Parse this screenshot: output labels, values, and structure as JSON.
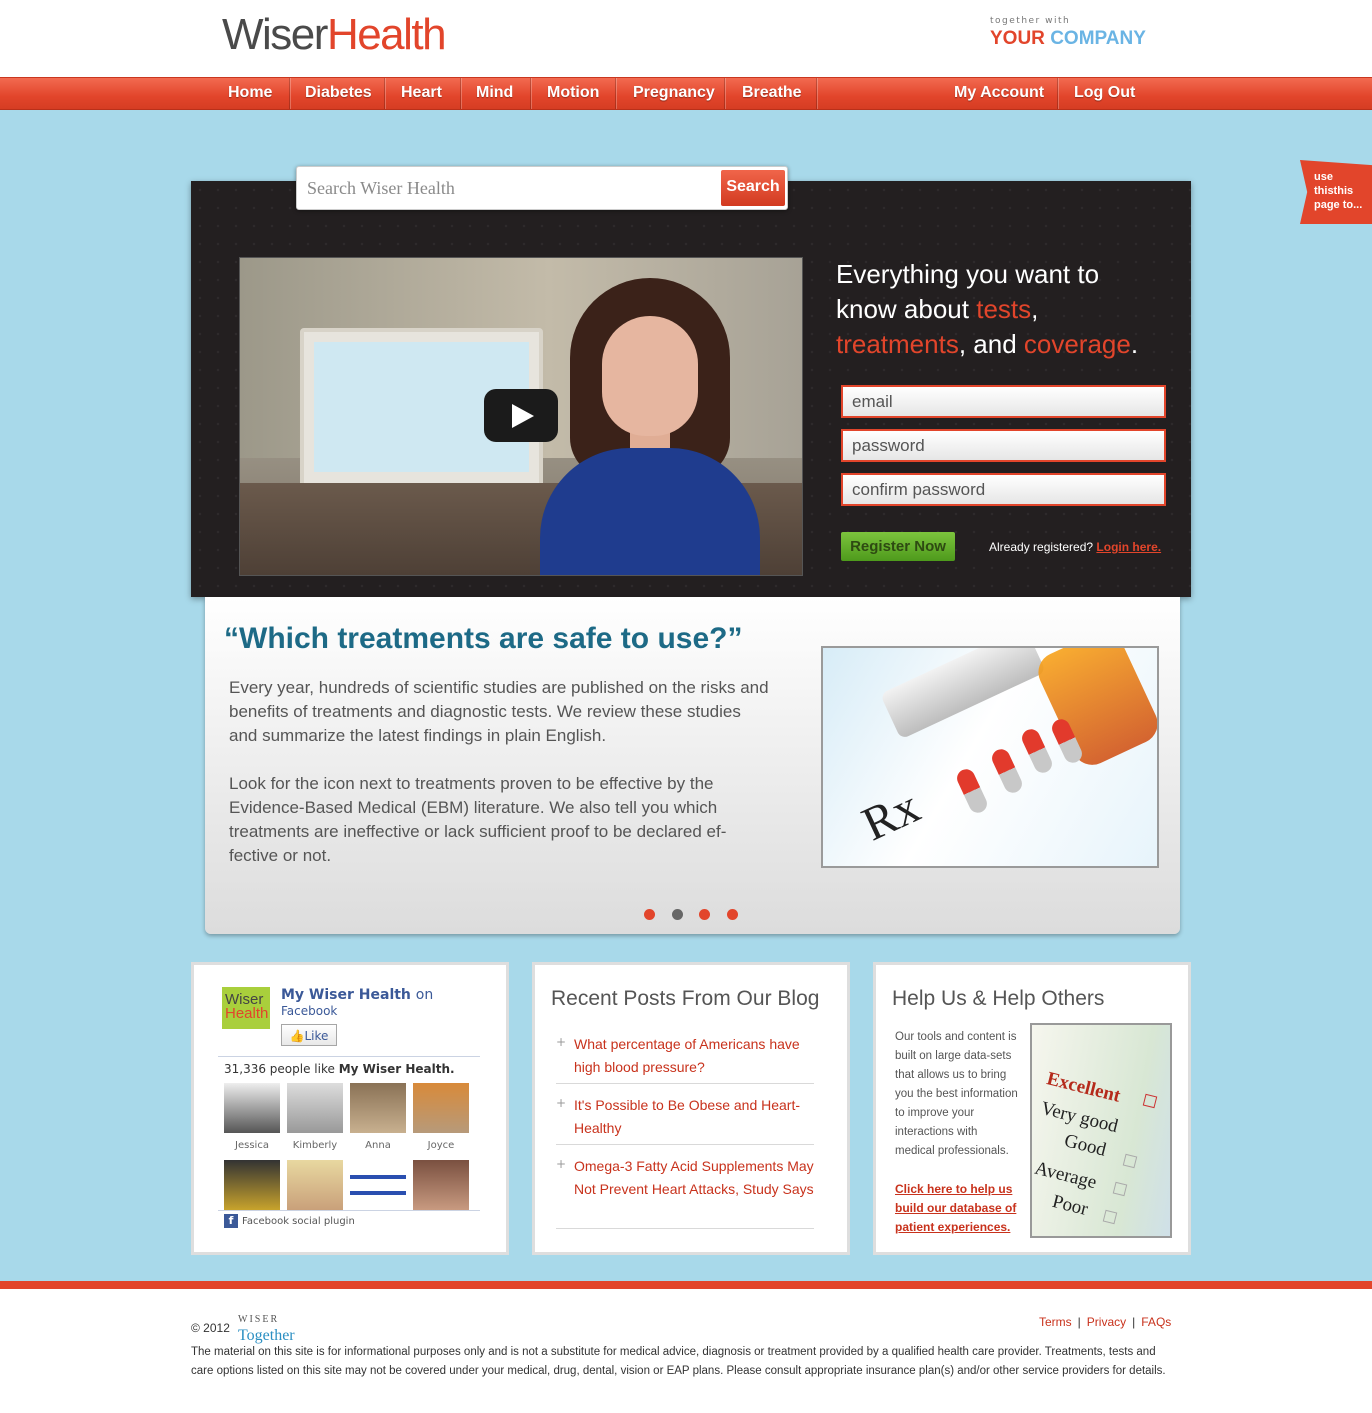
{
  "header": {
    "logo_part1": "Wiser",
    "logo_part2": "Health",
    "partner_small": "together with",
    "partner_your": "YOUR",
    "partner_company": "COMPANY"
  },
  "nav": {
    "items": [
      "Home",
      "Diabetes",
      "Heart",
      "Mind",
      "Motion",
      "Pregnancy",
      "Breathe"
    ],
    "account": "My Account",
    "logout": "Log Out"
  },
  "side_tab": {
    "text": "use thisthis page to..."
  },
  "search": {
    "placeholder": "Search Wiser Health",
    "button": "Search"
  },
  "hero": {
    "headline_1": "Everything you want to know about ",
    "tests": "tests",
    "comma": ", ",
    "treatments": "treatments",
    "and": ", and ",
    "coverage": "coverage",
    "period": ".",
    "email_placeholder": "email",
    "password_placeholder": "password",
    "confirm_placeholder": "confirm password",
    "register_button": "Register Now",
    "already": "Already registered?",
    "login_link": "Login here."
  },
  "slide": {
    "quote": "“Which treatments are safe to use?”",
    "para1": "Every year, hundreds of scientific studies are published on the risks and benefits of treatments and diagnostic tests. We review these studies and summarize the latest findings in plain English.",
    "para2": "Look for the icon next to treatments proven to be effective by the Evidence-Based Medical (EBM) literature. We also tell you which treatments are ineffective or lack sufficient proof to be declared ef-fective or not.",
    "image_label": "Rx",
    "active_dot": 2,
    "dot_count": 4
  },
  "facebook": {
    "logo_1": "Wiser",
    "logo_2": "Health",
    "title": "My Wiser Health",
    "on": "on",
    "facebook": "Facebook",
    "like": "Like",
    "count_text": "31,336 people like",
    "count_page": "My Wiser Health.",
    "fans": [
      "Jessica",
      "Kimberly",
      "Anna",
      "Joyce"
    ],
    "plugin": "Facebook social plugin"
  },
  "blog": {
    "title": "Recent Posts From Our Blog",
    "posts": [
      "What percentage of Americans have high blood pressure?",
      "It's Possible to Be Obese and Heart-Healthy",
      "Omega-3 Fatty Acid Supplements May Not Prevent Heart Attacks, Study Says"
    ]
  },
  "help": {
    "title": "Help Us & Help Others",
    "text": "Our tools and content is built on large data-sets that allows us to bring you the best information to improve your interactions with medical professionals.",
    "link": "Click here to help us build our database of patient experiences.",
    "survey_options": [
      "Excellent",
      "Very good",
      "Good",
      "Average",
      "Poor"
    ]
  },
  "footer": {
    "copyright": "© 2012",
    "logo_top": "WISER",
    "logo_bottom": "Together",
    "links": [
      "Terms",
      "Privacy",
      "FAQs"
    ],
    "disclaimer": "The material on this site is for informational purposes only and is not a substitute for medical advice, diagnosis or treatment provided by a qualified health care provider. Treatments, tests and care options listed on this site may not be covered under your medical, drug, dental, vision or EAP plans. Please consult appropriate insurance plan(s) and/or other service providers for details."
  },
  "colors": {
    "brand_red": "#e2452b",
    "brand_blue": "#6ab4e4",
    "page_bg": "#a8d9ea",
    "dark": "#231f20"
  }
}
